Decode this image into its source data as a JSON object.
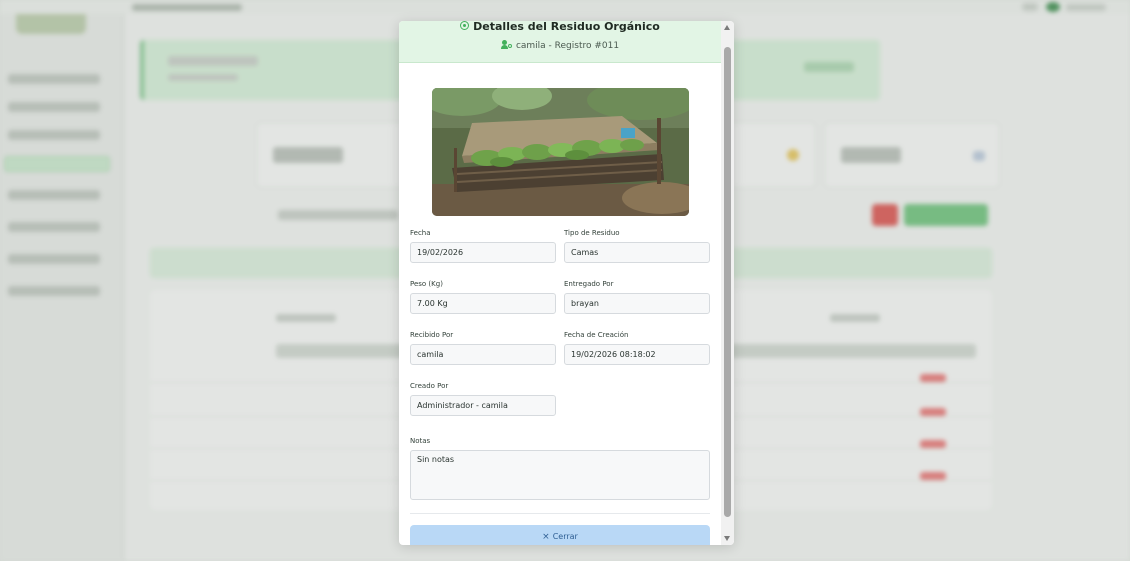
{
  "modal": {
    "title": "Detalles del Residuo Orgánico",
    "subtitle": "camila - Registro #011",
    "fields": {
      "fecha": {
        "label": "Fecha",
        "value": "19/02/2026"
      },
      "tipo_residuo": {
        "label": "Tipo de Residuo",
        "value": "Camas"
      },
      "peso": {
        "label": "Peso (Kg)",
        "value": "7.00 Kg"
      },
      "entregado_por": {
        "label": "Entregado Por",
        "value": "brayan"
      },
      "recibido_por": {
        "label": "Recibido Por",
        "value": "camila"
      },
      "fecha_creacion": {
        "label": "Fecha de Creación",
        "value": "19/02/2026 08:18:02"
      },
      "creado_por": {
        "label": "Creado Por",
        "value": "Administrador - camila"
      },
      "notas": {
        "label": "Notas",
        "value": "Sin notas"
      }
    },
    "close_icon": "×",
    "close_label": "Cerrar",
    "icons": {
      "title_icon": "eye-icon",
      "subtitle_icon": "user-icon"
    },
    "colors": {
      "header_bg": "#e2f5e5",
      "accent_green": "#43b05c",
      "close_button_bg": "#b9d8f6"
    }
  }
}
